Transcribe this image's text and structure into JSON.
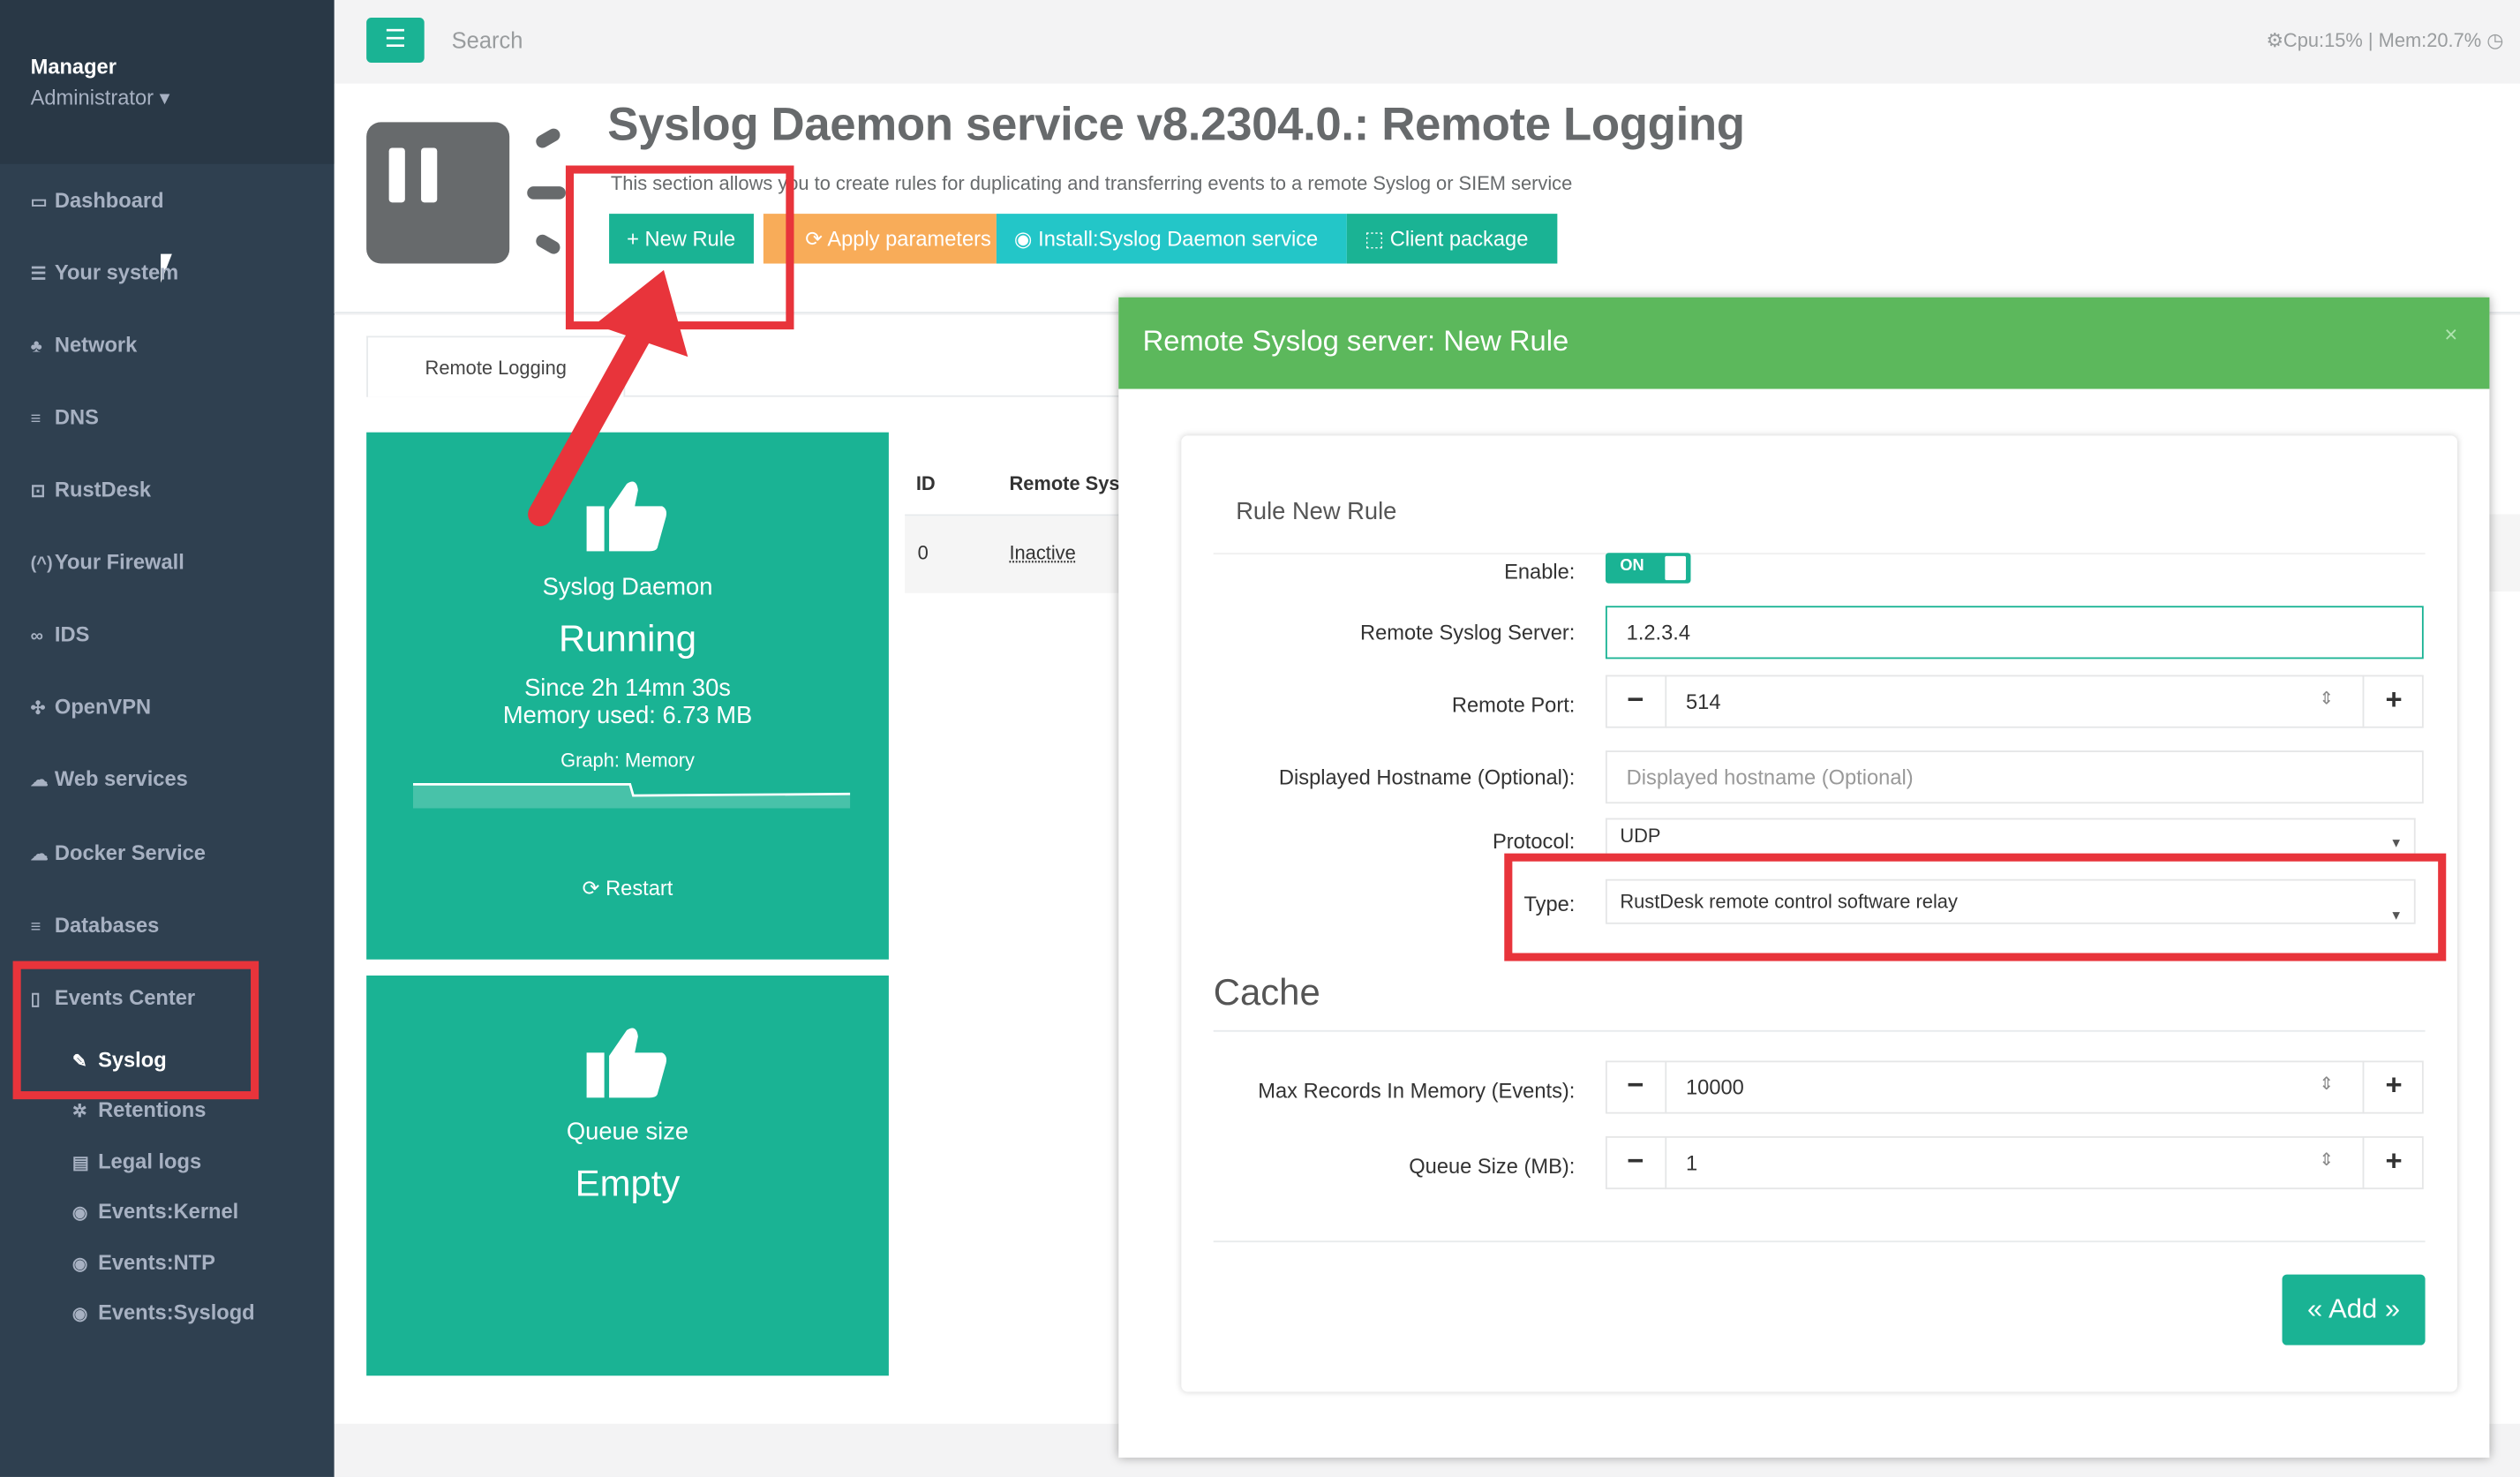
{
  "sidebar": {
    "profile": {
      "name": "Manager",
      "role": "Administrator ▾"
    },
    "items": [
      {
        "label": "Dashboard",
        "icon": "dashboard-icon",
        "glyph": "▭"
      },
      {
        "label": "Your system",
        "icon": "server-icon",
        "glyph": "☰"
      },
      {
        "label": "Network",
        "icon": "network-icon",
        "glyph": "♣"
      },
      {
        "label": "DNS",
        "icon": "database-icon",
        "glyph": "≡"
      },
      {
        "label": "RustDesk",
        "icon": "remote-desktop-icon",
        "glyph": "⊡"
      },
      {
        "label": "Your Firewall",
        "icon": "firewall-icon",
        "glyph": "(^)"
      },
      {
        "label": "IDS",
        "icon": "binoculars-icon",
        "glyph": "∞"
      },
      {
        "label": "OpenVPN",
        "icon": "vpn-icon",
        "glyph": "✣"
      },
      {
        "label": "Web services",
        "icon": "cloud-icon",
        "glyph": "☁"
      },
      {
        "label": "Docker Service",
        "icon": "docker-icon",
        "glyph": "☁"
      },
      {
        "label": "Databases",
        "icon": "database-icon",
        "glyph": "≡"
      },
      {
        "label": "Events Center",
        "icon": "file-icon",
        "glyph": "▯"
      }
    ],
    "subitems": [
      {
        "label": "Syslog",
        "icon": "wrench-icon",
        "glyph": "✎",
        "active": true
      },
      {
        "label": "Retentions",
        "icon": "cogs-icon",
        "glyph": "✲"
      },
      {
        "label": "Legal logs",
        "icon": "file-text-icon",
        "glyph": "▤"
      },
      {
        "label": "Events:Kernel",
        "icon": "eye-icon",
        "glyph": "◉"
      },
      {
        "label": "Events:NTP",
        "icon": "eye-icon",
        "glyph": "◉"
      },
      {
        "label": "Events:Syslogd",
        "icon": "eye-icon",
        "glyph": "◉"
      }
    ]
  },
  "topbar": {
    "menu_glyph": "☰",
    "search_placeholder": "Search",
    "stats": "⚙Cpu:15% | Mem:20.7%  ◷"
  },
  "header": {
    "title": "Syslog Daemon service v8.2304.0.: Remote Logging",
    "description": "This section allows you to create rules for duplicating and transferring events to a remote Syslog or SIEM service",
    "buttons": {
      "new_rule": "+ New Rule",
      "apply": "⟳ Apply parameters",
      "install": "◉ Install:Syslog Daemon service",
      "client": "⬚ Client package"
    }
  },
  "tabs": {
    "remote_logging": "Remote Logging"
  },
  "status_card": {
    "name": "Syslog Daemon",
    "state": "Running",
    "since": "Since 2h 14mn 30s",
    "memory": "Memory used: 6.73 MB",
    "graph_label": "Graph: Memory",
    "restart": "⟳ Restart"
  },
  "queue_card": {
    "label": "Queue size",
    "value": "Empty"
  },
  "table": {
    "headers": [
      "ID",
      "Remote Sysl"
    ],
    "rows": [
      {
        "id": "0",
        "status": "Inactive"
      }
    ]
  },
  "modal": {
    "title": "Remote Syslog server: New Rule",
    "close": "×",
    "section_title": "Rule New Rule",
    "enable": {
      "label": "Enable:",
      "value": "ON"
    },
    "server": {
      "label": "Remote Syslog Server:",
      "value": "1.2.3.4"
    },
    "port": {
      "label": "Remote Port:",
      "value": "514"
    },
    "hostname": {
      "label": "Displayed Hostname (Optional):",
      "placeholder": "Displayed hostname (Optional)"
    },
    "protocol": {
      "label": "Protocol:",
      "value": "UDP"
    },
    "type": {
      "label": "Type:",
      "value": "RustDesk remote control software relay"
    },
    "cache_title": "Cache",
    "max_records": {
      "label": "Max Records In Memory (Events):",
      "value": "10000"
    },
    "queue_size": {
      "label": "Queue Size (MB):",
      "value": "1"
    },
    "add_button": "« Add »",
    "stepper": {
      "minus": "−",
      "plus": "+",
      "spin": "⇕"
    }
  },
  "colors": {
    "sidebar": "#2f4050",
    "primary": "#1ab394",
    "warning": "#f8ac59",
    "modal_header": "#5cb85c",
    "highlight": "#e8343b"
  }
}
